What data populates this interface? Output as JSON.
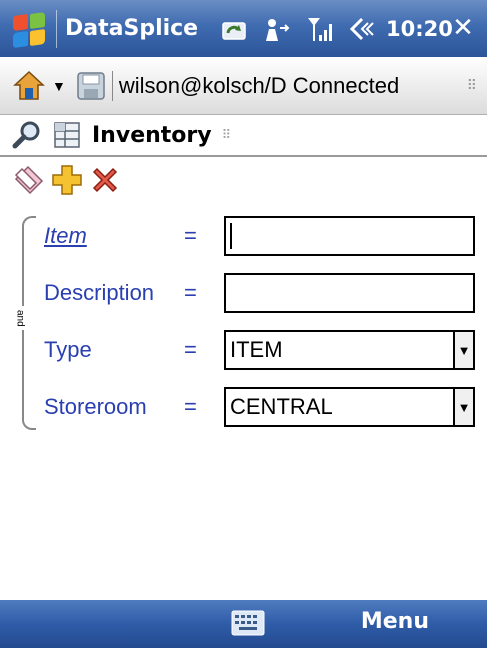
{
  "titlebar": {
    "app_title": "DataSplice",
    "time": "10:20",
    "icons": [
      "windows-logo-icon",
      "sync-icon",
      "connectivity-icon",
      "signal-icon",
      "volume-icon"
    ],
    "close_label": "✕"
  },
  "connbar": {
    "connection_text": "wilson@kolsch/D Connected",
    "icons": [
      "home-icon",
      "chevron-down-icon",
      "save-icon"
    ]
  },
  "view": {
    "title": "Inventory",
    "icons": [
      "search-icon",
      "table-view-icon"
    ]
  },
  "actions": {
    "icons": [
      "eraser-icon",
      "add-icon",
      "delete-icon"
    ]
  },
  "form": {
    "group_label": "and",
    "fields": [
      {
        "label": "Item",
        "operator": "=",
        "value": "",
        "kind": "text"
      },
      {
        "label": "Description",
        "operator": "=",
        "value": "",
        "kind": "text"
      },
      {
        "label": "Type",
        "operator": "=",
        "value": "ITEM",
        "kind": "select"
      },
      {
        "label": "Storeroom",
        "operator": "=",
        "value": "CENTRAL",
        "kind": "select"
      }
    ]
  },
  "softkeys": {
    "left": "",
    "right": "Menu",
    "center_icon": "keyboard-icon"
  },
  "colors": {
    "titlebar": "#3f6bb0",
    "label": "#2a3fb0",
    "softbar": "#2f5ca8"
  }
}
